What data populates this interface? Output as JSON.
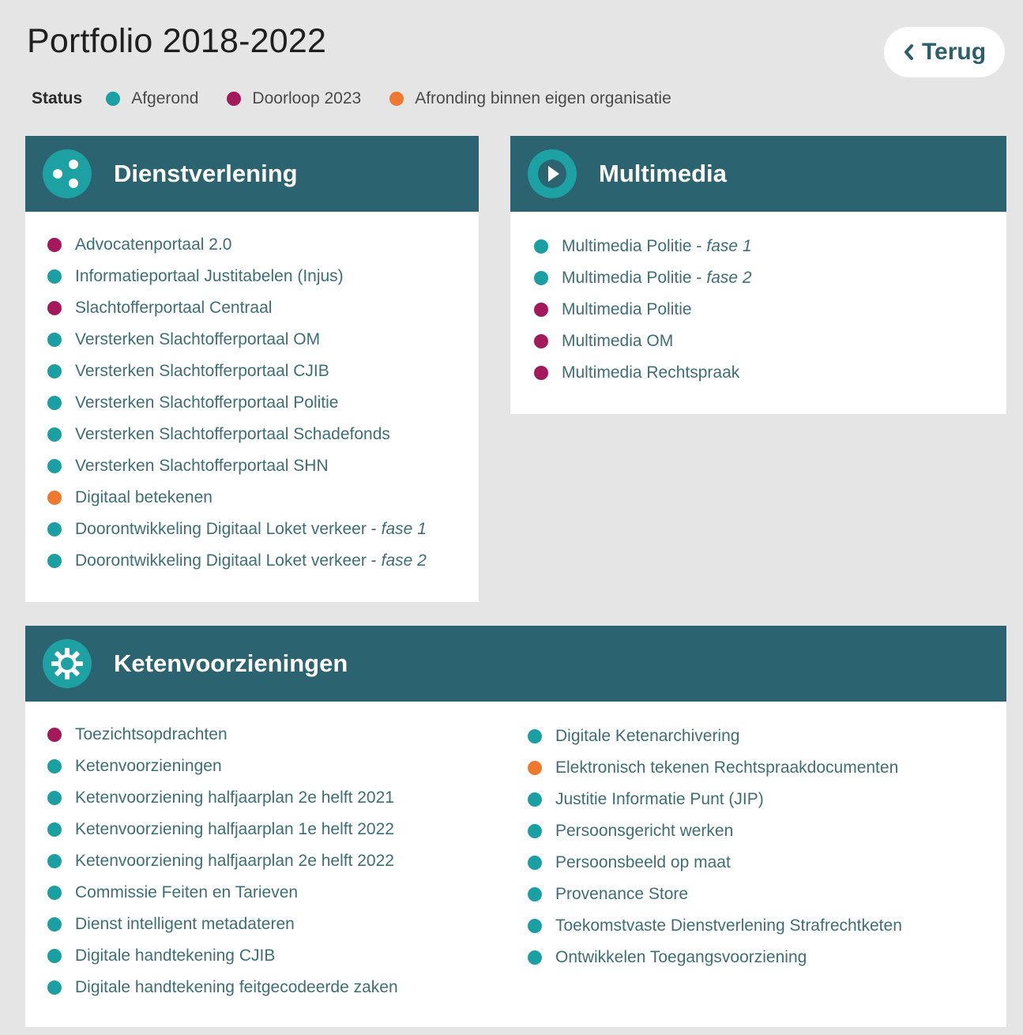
{
  "header": {
    "title": "Portfolio 2018-2022",
    "back_label": "Terug"
  },
  "status": {
    "label": "Status",
    "legend": [
      {
        "label": "Afgerond",
        "color": "#1aa0a2"
      },
      {
        "label": "Doorloop 2023",
        "color": "#a3195b"
      },
      {
        "label": "Afronding binnen eigen organisatie",
        "color": "#ef7a2f"
      }
    ]
  },
  "colors": {
    "afgerond": "#1aa0a2",
    "doorloop": "#a3195b",
    "eigen": "#ef7a2f",
    "header_bg": "#2b6370"
  },
  "sections": {
    "dienstverlening": {
      "title": "Dienstverlening",
      "icon": "dots-share-icon",
      "items": [
        {
          "name": "Advocatenportaal 2.0",
          "status": "doorloop"
        },
        {
          "name": "Informatieportaal Justitabelen (Injus)",
          "status": "afgerond"
        },
        {
          "name": "Slachtofferportaal Centraal",
          "status": "doorloop"
        },
        {
          "name": "Versterken Slachtofferportaal OM",
          "status": "afgerond"
        },
        {
          "name": "Versterken Slachtofferportaal CJIB",
          "status": "afgerond"
        },
        {
          "name": "Versterken Slachtofferportaal Politie",
          "status": "afgerond"
        },
        {
          "name": "Versterken Slachtofferportaal Schadefonds",
          "status": "afgerond"
        },
        {
          "name": "Versterken Slachtofferportaal SHN",
          "status": "afgerond"
        },
        {
          "name": "Digitaal betekenen",
          "status": "eigen"
        },
        {
          "name": "Doorontwikkeling Digitaal Loket verkeer -",
          "suffix": "fase 1",
          "status": "afgerond"
        },
        {
          "name": "Doorontwikkeling Digitaal Loket verkeer -",
          "suffix": "fase 2",
          "status": "afgerond"
        }
      ]
    },
    "multimedia": {
      "title": "Multimedia",
      "icon": "play-icon",
      "items": [
        {
          "name": "Multimedia Politie -",
          "suffix": "fase 1",
          "status": "afgerond"
        },
        {
          "name": "Multimedia Politie -",
          "suffix": "fase 2",
          "status": "afgerond"
        },
        {
          "name": "Multimedia Politie",
          "status": "doorloop"
        },
        {
          "name": "Multimedia OM",
          "status": "doorloop"
        },
        {
          "name": "Multimedia Rechtspraak",
          "status": "doorloop"
        }
      ]
    },
    "ketenvoorzieningen": {
      "title": "Ketenvoorzieningen",
      "icon": "gear-icon",
      "items_left": [
        {
          "name": "Toezichtsopdrachten",
          "status": "doorloop"
        },
        {
          "name": "Ketenvoorzieningen",
          "status": "afgerond"
        },
        {
          "name": "Ketenvoorziening halfjaarplan 2e helft 2021",
          "status": "afgerond"
        },
        {
          "name": "Ketenvoorziening halfjaarplan 1e helft 2022",
          "status": "afgerond"
        },
        {
          "name": "Ketenvoorziening halfjaarplan 2e helft 2022",
          "status": "afgerond"
        },
        {
          "name": "Commissie Feiten en Tarieven",
          "status": "afgerond"
        },
        {
          "name": "Dienst intelligent metadateren",
          "status": "afgerond"
        },
        {
          "name": "Digitale handtekening CJIB",
          "status": "afgerond"
        },
        {
          "name": "Digitale handtekening feitgecodeerde zaken",
          "status": "afgerond"
        }
      ],
      "items_right": [
        {
          "name": "Digitale Ketenarchivering",
          "status": "afgerond"
        },
        {
          "name": "Elektronisch tekenen Rechtspraakdocumenten",
          "status": "eigen"
        },
        {
          "name": "Justitie Informatie Punt (JIP)",
          "status": "afgerond"
        },
        {
          "name": "Persoonsgericht werken",
          "status": "afgerond"
        },
        {
          "name": "Persoonsbeeld op maat",
          "status": "afgerond"
        },
        {
          "name": "Provenance Store",
          "status": "afgerond"
        },
        {
          "name": "Toekomstvaste Dienstverlening Strafrechtketen",
          "status": "afgerond"
        },
        {
          "name": "Ontwikkelen Toegangsvoorziening",
          "status": "afgerond"
        }
      ]
    }
  }
}
